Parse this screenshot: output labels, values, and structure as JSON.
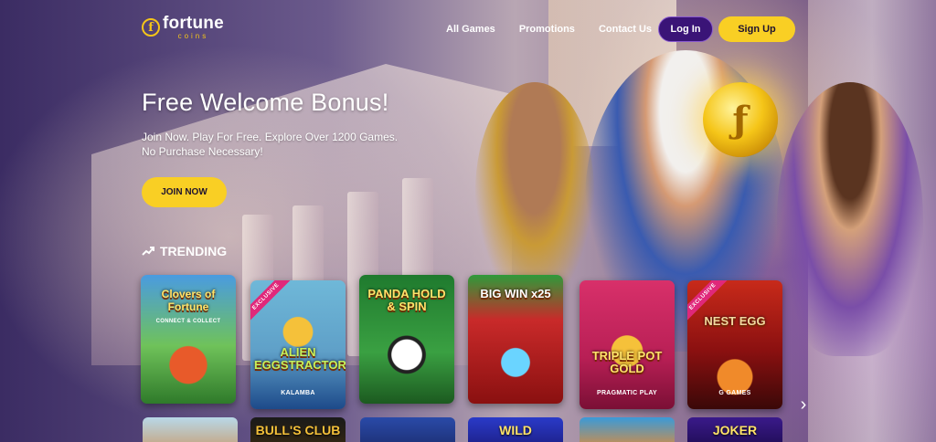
{
  "header": {
    "logo": {
      "word": "fortune",
      "sub": "coins",
      "mark": "f"
    },
    "nav": [
      "All Games",
      "Promotions",
      "Contact Us"
    ],
    "login_label": "Log In",
    "signup_label": "Sign Up"
  },
  "hero": {
    "title": "Free Welcome Bonus!",
    "subtitle_line1": "Join Now. Play For Free. Explore Over 1200 Games.",
    "subtitle_line2": "No Purchase Necessary!",
    "join_label": "JOIN NOW"
  },
  "trending": {
    "label": "TRENDING",
    "icon": "trending-up-icon",
    "cards": [
      {
        "title": "Clovers of Fortune",
        "tagline": "CONNECT & COLLECT",
        "provider": "",
        "exclusive": ""
      },
      {
        "title": "ALIEN EGGSTRACTORS",
        "tagline": "",
        "provider": "KALAMBA",
        "exclusive": "EXCLUSIVE"
      },
      {
        "title": "PANDA HOLD & SPIN",
        "tagline": "",
        "provider": "",
        "exclusive": ""
      },
      {
        "title": "BIG WIN x25",
        "tagline": "",
        "provider": "",
        "exclusive": ""
      },
      {
        "title": "TRIPLE POT GOLD",
        "tagline": "",
        "provider": "PRAGMATIC PLAY",
        "exclusive": ""
      },
      {
        "title": "NEST EGG",
        "tagline": "",
        "provider": "G GAMES",
        "exclusive": "EXCLUSIVE"
      }
    ],
    "next_icon": "chevron-right-icon",
    "row2": [
      "",
      "BULL'S CLUB",
      "",
      "WILD",
      "",
      "JOKER"
    ]
  },
  "colors": {
    "accent_yellow": "#f9cf24",
    "login_purple": "#3a1477",
    "exclusive_pink": "#e0287a"
  }
}
